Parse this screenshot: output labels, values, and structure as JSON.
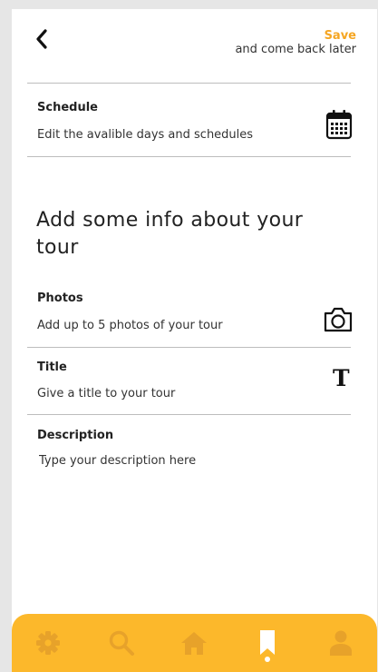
{
  "header": {
    "back_icon": "chevron-left-icon",
    "save_label": "Save",
    "save_sub": "and come back later"
  },
  "schedule": {
    "title": "Schedule",
    "desc": "Edit the avalible days and schedules",
    "icon": "calendar-icon"
  },
  "info_heading": "Add some info about your tour",
  "photos": {
    "title": "Photos",
    "desc": "Add up to 5 photos of your tour",
    "icon": "camera-icon"
  },
  "title_field": {
    "title": "Title",
    "desc": "Give a title to your tour",
    "icon_text": "T"
  },
  "description": {
    "title": "Description",
    "placeholder": "Type your description here"
  },
  "tabbar": {
    "background": "#fcb82b",
    "icon_color": "#e7a22a",
    "active_color": "#ffffff",
    "tabs": [
      {
        "icon": "gear-icon"
      },
      {
        "icon": "search-icon"
      },
      {
        "icon": "home-icon"
      },
      {
        "icon": "bookmark-icon",
        "active": true
      },
      {
        "icon": "user-icon"
      }
    ]
  },
  "colors": {
    "accent": "#f5a623"
  }
}
